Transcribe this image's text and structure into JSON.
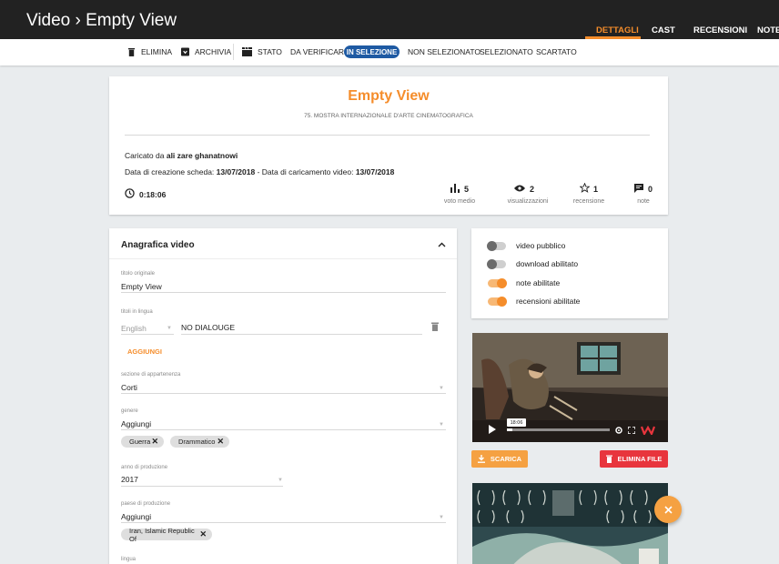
{
  "header": {
    "title": "Video › Empty View",
    "tabs": [
      "DETTAGLI",
      "CAST",
      "RECENSIONI",
      "NOTE"
    ]
  },
  "toolbar": {
    "elimina": "ELIMINA",
    "archivia": "ARCHIVIA",
    "stato": "STATO",
    "statuses": [
      "DA VERIFICARE",
      "IN SELEZIONE",
      "NON SELEZIONATO",
      "SELEZIONATO",
      "SCARTATO"
    ]
  },
  "summary": {
    "title": "Empty View",
    "festival": "75. MOSTRA INTERNAZIONALE D'ARTE CINEMATOGRAFICA",
    "uploaded_prefix": "Caricato da",
    "uploader": "ali zare ghanatnowi",
    "created_label": "Data di creazione scheda:",
    "created": "13/07/2018",
    "dash": "-",
    "upload_label": "Data di caricamento video:",
    "upload": "13/07/2018",
    "duration": "0:18:06",
    "stats": [
      {
        "value": "5",
        "label": "voto medio",
        "icon": "bar-chart-icon"
      },
      {
        "value": "2",
        "label": "visualizzazioni",
        "icon": "eye-icon"
      },
      {
        "value": "1",
        "label": "recensione",
        "icon": "star-icon"
      },
      {
        "value": "0",
        "label": "note",
        "icon": "comment-icon"
      }
    ]
  },
  "form": {
    "heading": "Anagrafica video",
    "title_label": "titolo originale",
    "title_value": "Empty View",
    "lang_titles_label": "titoli in lingua",
    "lang_select": "English",
    "lang_title_value": "NO DIALOUGE",
    "add_label": "AGGIUNGI",
    "section_label": "sezione di appartenenza",
    "section_value": "Corti",
    "genre_label": "genere",
    "genre_value": "Aggiungi",
    "genres": [
      "Guerra",
      "Drammatico"
    ],
    "year_label": "anno di produzione",
    "year_value": "2017",
    "country_label": "paese di produzione",
    "country_value": "Aggiungi",
    "countries": [
      "Iran, Islamic Republic Of"
    ],
    "lingua_label": "lingua"
  },
  "toggles": [
    {
      "label": "video pubblico",
      "on": false
    },
    {
      "label": "download abilitato",
      "on": false
    },
    {
      "label": "note abilitate",
      "on": true
    },
    {
      "label": "recensioni abilitate",
      "on": true
    }
  ],
  "video": {
    "time": "18:06",
    "download_label": "SCARICA",
    "delete_label": "ELIMINA FILE",
    "progress": 0.05
  },
  "colors": {
    "accent": "#f58d2b",
    "primary": "#1e5aa3",
    "danger": "#e8353d",
    "topbar": "#222222"
  }
}
